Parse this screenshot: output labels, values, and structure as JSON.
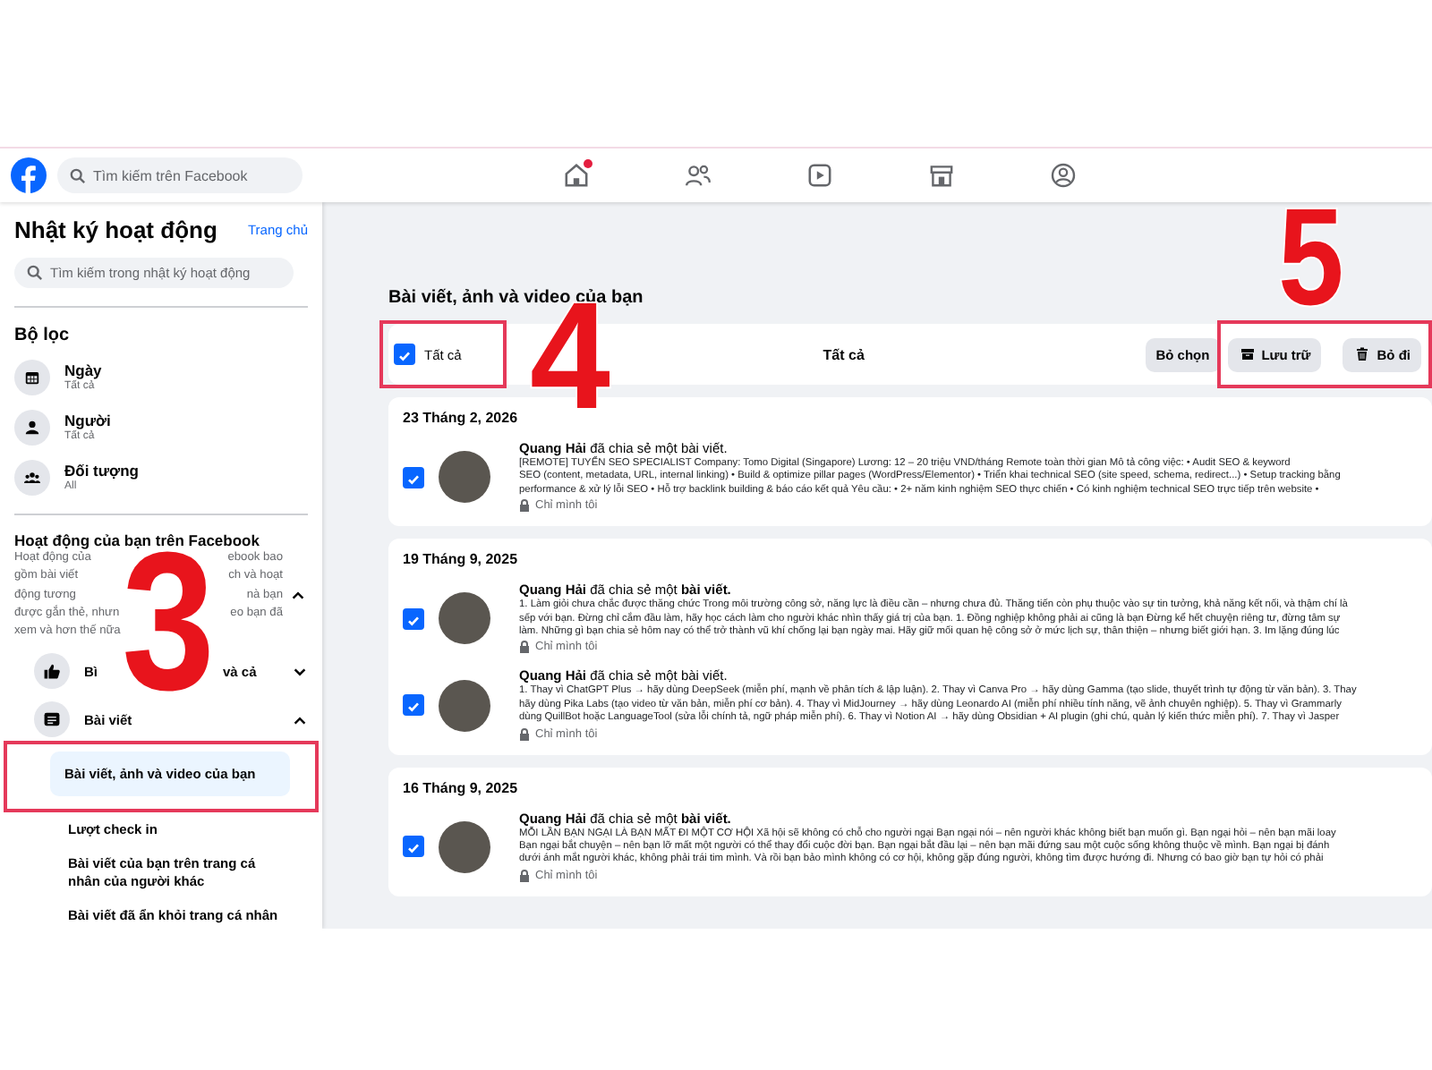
{
  "header": {
    "search": {
      "placeholder": "Tìm kiếm trên Facebook"
    },
    "nav": [
      {
        "badge": true
      },
      {
        "badge": false
      },
      {
        "badge": false
      },
      {
        "badge": false
      },
      {
        "badge": false
      }
    ]
  },
  "sidebar": {
    "title": "Nhật ký hoạt động",
    "home_link": "Trang chủ",
    "search": {
      "placeholder": "Tìm kiếm trong nhật ký hoạt động"
    },
    "filters_title": "Bộ lọc",
    "filters": [
      {
        "label": "Ngày",
        "value": "Tất cả"
      },
      {
        "label": "Người",
        "value": "Tất cả"
      },
      {
        "label": "Đối tượng",
        "value": "All"
      }
    ],
    "section": {
      "title": "Hoạt động của bạn trên Facebook",
      "expanded": true,
      "description_lines": [
        [
          "Hoạt động của",
          "ebook bao"
        ],
        [
          "gồm bài viết",
          "ch và hoạt"
        ],
        [
          "động tương",
          "nà bạn"
        ],
        [
          "được gắn thẻ, nhưn",
          "eo bạn đã"
        ],
        [
          "xem và hơn thế nữa"
        ]
      ],
      "groups": [
        {
          "label_parts": [
            "Bì",
            "và cả"
          ],
          "expanded": false
        },
        {
          "label_parts": [
            "Bài viết"
          ],
          "expanded": true,
          "items": [
            {
              "label": "Bài viết, ảnh và video của bạn",
              "selected": true,
              "highlighted": true
            },
            {
              "label": "Lượt check in",
              "selected": false,
              "highlighted": false
            },
            {
              "label": "Bài viết của bạn trên trang cá nhân của người khác",
              "selected": false,
              "highlighted": false
            },
            {
              "label": "Bài viết đã ẩn khỏi trang cá nhân",
              "selected": false,
              "highlighted": false
            }
          ]
        }
      ]
    }
  },
  "main": {
    "title": "Bài viết, ảnh và video của bạn",
    "toolbar": {
      "select_all": {
        "label": "Tất cả",
        "checked": true,
        "highlighted": true
      },
      "filter_label": "Tất cả",
      "deselect": "Bỏ chọn",
      "actions_highlighted": true,
      "actions": [
        {
          "label": "Lưu trữ"
        },
        {
          "label": "Bỏ đi"
        }
      ]
    },
    "sections": [
      {
        "date": "23 Tháng 2, 2026",
        "posts": [
          {
            "checked": true,
            "headline": "**Quang Hải** đã chia sẻ một bài viết.",
            "body_lines": [
              "[REMOTE] TUYỂN SEO SPECIALIST Company: Tomo Digital (Singapore) Lương: 12 – 20 triệu VND/tháng Remote toàn thời gian Mô tả công việc: • Audit SEO & keyword",
              "SEO (content, metadata, URL, internal linking) • Build & optimize pillar pages (WordPress/Elementor) • Triển khai technical SEO (site speed, schema, redirect...) • Setup tracking bằng",
              "performance & xử lý lỗi SEO • Hỗ trợ backlink building & báo cáo kết quả Yêu cầu: • 2+ năm kinh nghiệm SEO thực chiến • Có kinh nghiệm technical SEO trực tiếp trên website •"
            ],
            "privacy": "Chỉ mình tôi"
          }
        ]
      },
      {
        "date": "19 Tháng 9, 2025",
        "posts": [
          {
            "checked": true,
            "headline": "**Quang Hải** đã chia sẻ một **bài viết.**",
            "body_lines": [
              "1. Làm giỏi chưa chắc được thăng chức Trong môi trường công sở, năng lực là điều cần – nhưng chưa đủ. Thăng tiến còn phụ thuộc vào sự tin tưởng, khả năng kết nối, và thậm chí là",
              "sếp với bạn. Đừng chỉ cắm đầu làm, hãy học cách làm cho người khác nhìn thấy giá trị của bạn. 1. Đồng nghiệp không phải ai cũng là bạn Đừng kể hết chuyện riêng tư, đừng tâm sự",
              "làm. Những gì bạn chia sẻ hôm nay có thể trở thành vũ khí chống lại bạn ngày mai. Hãy giữ mối quan hệ công sở ở mức lịch sự, thân thiện – nhưng biết giới hạn. 3. Im lặng đúng lúc"
            ],
            "privacy": "Chỉ mình tôi"
          },
          {
            "checked": true,
            "headline": "**Quang Hải** đã chia sẻ một bài viết.",
            "body_lines": [
              "1. Thay vì ChatGPT Plus → hãy dùng DeepSeek (miễn phí, mạnh về phân tích & lập luận). 2. Thay vì Canva Pro → hãy dùng Gamma (tạo slide, thuyết trình tự động từ văn bản). 3. Thay",
              "hãy dùng Pika Labs (tạo video từ văn bản, miễn phí cơ bản). 4. Thay vì MidJourney → hãy dùng Leonardo AI (miễn phí nhiều tính năng, vẽ ảnh chuyên nghiệp). 5. Thay vì Grammarly",
              "dùng QuillBot hoặc LanguageTool (sửa lỗi chính tả, ngữ pháp miễn phí). 6. Thay vì Notion AI → hãy dùng Obsidian + AI plugin (ghi chú, quản lý kiến thức miễn phí). 7. Thay vì Jasper"
            ],
            "privacy": "Chỉ mình tôi"
          }
        ]
      },
      {
        "date": "16 Tháng 9, 2025",
        "posts": [
          {
            "checked": true,
            "headline": "**Quang Hải** đã chia sẻ một **bài viết.**",
            "body_lines": [
              "MỖI LẦN BẠN NGẠI LÀ BẠN MẤT ĐI MỘT CƠ HỘI Xã hội sẽ không có chỗ cho người ngại Bạn ngại nói – nên người khác không biết bạn muốn gì. Bạn ngại hỏi – nên bạn mãi loay",
              "Bạn ngại bắt chuyện – nên bạn lỡ mất một người có thể thay đổi cuộc đời bạn. Bạn ngại bắt đầu lại – nên bạn mãi đứng sau một cuộc sống không thuộc về mình. Bạn ngại bị đánh",
              "dưới ánh mắt người khác, không phải trái tim mình. Và rồi bạn bảo mình không có cơ hội, không gặp đúng người, không tìm được hướng đi. Nhưng có bao giờ bạn tự hỏi có phải"
            ],
            "privacy": "Chỉ mình tôi"
          }
        ]
      }
    ]
  },
  "callouts": [
    {
      "text": "3"
    },
    {
      "text": "4"
    },
    {
      "text": "5"
    }
  ]
}
